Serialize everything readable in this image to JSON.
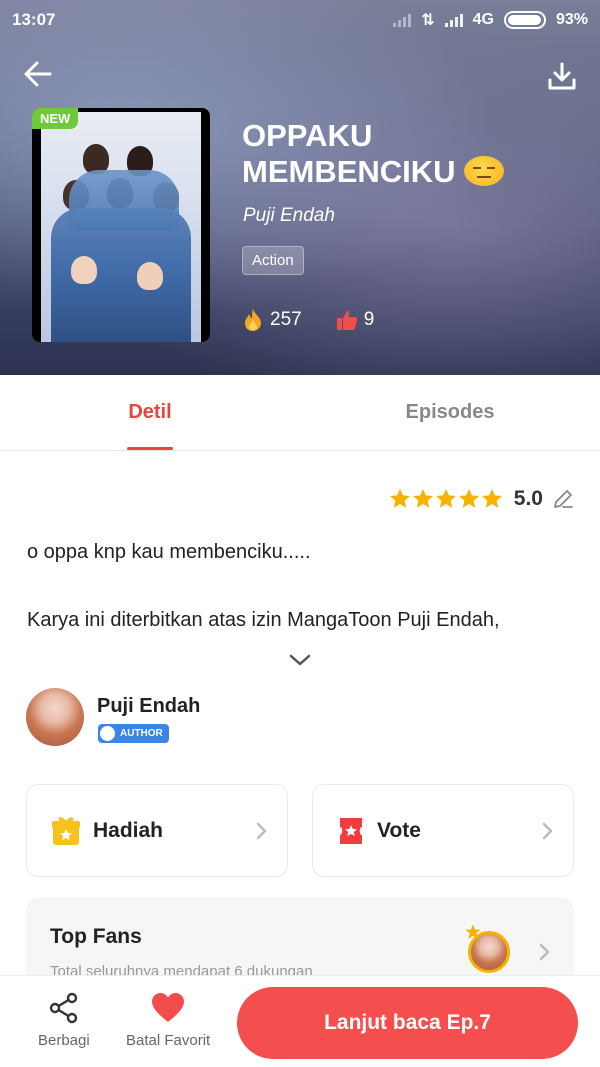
{
  "status_bar": {
    "time": "13:07",
    "network": "4G",
    "battery": "93%"
  },
  "comic": {
    "badge": "NEW",
    "title": "OPPAKU MEMBENCIKU",
    "emoji": "expressionless-face",
    "author": "Puji Endah",
    "genre": "Action",
    "views": "257",
    "likes": "9"
  },
  "tabs": [
    {
      "label": "Detil",
      "active": true
    },
    {
      "label": "Episodes",
      "active": false
    }
  ],
  "details": {
    "rating_stars": 5,
    "rating_value": "5.0",
    "description_line1": "o oppa knp kau membenciku.....",
    "description_line2": "Karya ini diterbitkan atas izin MangaToon Puji Endah,"
  },
  "author": {
    "name": "Puji Endah",
    "badge": "AUTHOR"
  },
  "actions": {
    "gift_label": "Hadiah",
    "vote_label": "Vote"
  },
  "top_fans": {
    "title": "Top Fans",
    "subtitle": "Total seluruhnya mendapat 6 dukungan"
  },
  "bottom_bar": {
    "share_label": "Berbagi",
    "unfavorite_label": "Batal Favorit",
    "continue_label": "Lanjut baca Ep.7"
  },
  "colors": {
    "accent": "#e8453c",
    "cta": "#f44e4e",
    "star": "#f5b300",
    "new_badge": "#6fca3a"
  }
}
